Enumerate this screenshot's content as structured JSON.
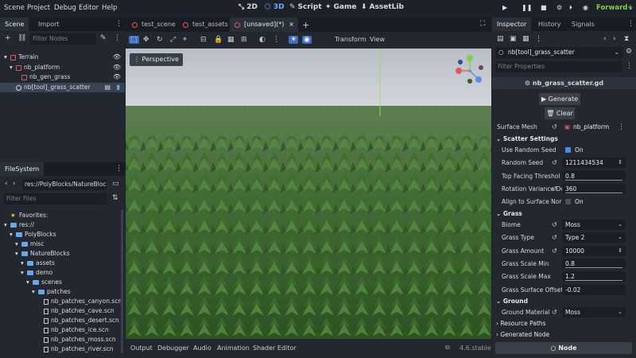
{
  "menubar": {
    "menus": [
      "Scene",
      "Project",
      "Debug",
      "Editor",
      "Help"
    ],
    "workspaces": [
      "2D",
      "3D",
      "Script",
      "Game",
      "AssetLib"
    ],
    "active_workspace": "3D",
    "renderer": "Forward+"
  },
  "scene_dock": {
    "tabs": [
      "Scene",
      "Import"
    ],
    "filter_placeholder": "Filter Nodes",
    "nodes": [
      {
        "label": "Terrain",
        "depth": 0,
        "visible": true
      },
      {
        "label": "nb_platform",
        "depth": 1,
        "visible": true
      },
      {
        "label": "nb_gen_grass",
        "depth": 2,
        "visible": true
      },
      {
        "label": "nb[tool]_grass_scatter",
        "depth": 1,
        "visible": false,
        "selected": true
      }
    ]
  },
  "filesystem": {
    "tab": "FileSystem",
    "path": "res://PolyBlocks/NatureBloc",
    "filter_placeholder": "Filter Files",
    "favorites_label": "Favorites:",
    "items": [
      {
        "label": "res://",
        "depth": 0,
        "kind": "folder"
      },
      {
        "label": "PolyBlocks",
        "depth": 1,
        "kind": "folder"
      },
      {
        "label": "misc",
        "depth": 2,
        "kind": "folder"
      },
      {
        "label": "NatureBlocks",
        "depth": 2,
        "kind": "folder"
      },
      {
        "label": "assets",
        "depth": 3,
        "kind": "folder"
      },
      {
        "label": "demo",
        "depth": 3,
        "kind": "folder"
      },
      {
        "label": "scenes",
        "depth": 4,
        "kind": "folder"
      },
      {
        "label": "patches",
        "depth": 5,
        "kind": "folder"
      },
      {
        "label": "nb_patches_canyon.scn",
        "depth": 6,
        "kind": "file"
      },
      {
        "label": "nb_patches_cave.scn",
        "depth": 6,
        "kind": "file"
      },
      {
        "label": "nb_patches_desert.scn",
        "depth": 6,
        "kind": "file"
      },
      {
        "label": "nb_patches_ice.scn",
        "depth": 6,
        "kind": "file"
      },
      {
        "label": "nb_patches_moss.scn",
        "depth": 6,
        "kind": "file"
      },
      {
        "label": "nb_patches_river.scn",
        "depth": 6,
        "kind": "file"
      }
    ]
  },
  "editor": {
    "scene_tabs": [
      "test_scene",
      "test_assets",
      "[unsaved](*)"
    ],
    "active_tab": "[unsaved](*)",
    "toolbar_menus": [
      "Transform",
      "View"
    ],
    "perspective_label": "Perspective",
    "bottom_tabs": [
      "Output",
      "Debugger",
      "Audio",
      "Animation",
      "Shader Editor"
    ],
    "version": "4.6.stable"
  },
  "inspector": {
    "tabs": [
      "Inspector",
      "History",
      "Signals"
    ],
    "node_path": "nb[tool]_grass_scatter",
    "filter_placeholder": "Filter Properties",
    "script_name": "nb_grass_scatter.gd",
    "generate_label": "Generate",
    "clear_label": "Clear",
    "surface_mesh": {
      "label": "Surface Mesh",
      "value": "nb_platform"
    },
    "sections": {
      "scatter": "Scatter Settings",
      "grass": "Grass",
      "ground": "Ground",
      "resource_paths": "Resource Paths",
      "generated_node": "Generated Node"
    },
    "scatter_props": [
      {
        "label": "Use Random Seed",
        "value": "On",
        "checked": true
      },
      {
        "label": "Random Seed",
        "value": "1211434534"
      },
      {
        "label": "Top Facing Threshol",
        "value": "0.8"
      },
      {
        "label": "Rotation Variance De",
        "value": "360"
      },
      {
        "label": "Align to Surface Nor",
        "value": "On",
        "checked": false
      }
    ],
    "grass_props": [
      {
        "label": "Biome",
        "value": "Moss"
      },
      {
        "label": "Grass Type",
        "value": "Type 2"
      },
      {
        "label": "Grass Amount",
        "value": "10000"
      },
      {
        "label": "Grass Scale Min",
        "value": "0.8"
      },
      {
        "label": "Grass Scale Max",
        "value": "1.2"
      },
      {
        "label": "Grass Surface Offset",
        "value": "-0.02"
      }
    ],
    "ground_props": [
      {
        "label": "Ground Material",
        "value": "Moss"
      }
    ],
    "node_button": "Node"
  },
  "colors": {
    "accent": "#3d6fbf",
    "renderer": "#7cd04a",
    "node_red": "#e55660"
  }
}
